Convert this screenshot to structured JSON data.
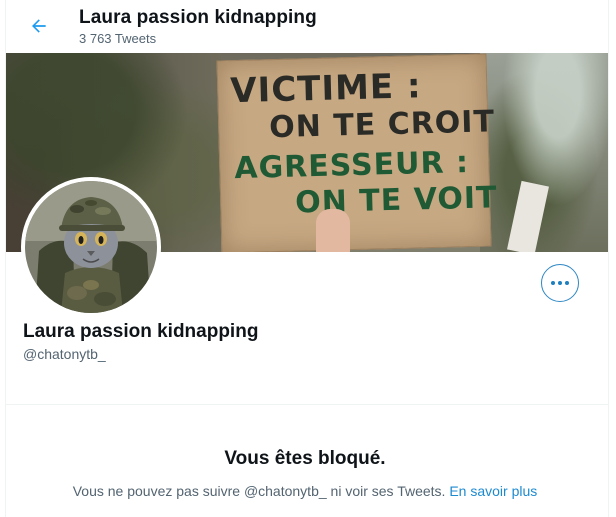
{
  "header": {
    "title": "Laura passion kidnapping",
    "tweet_count": "3 763 Tweets"
  },
  "banner": {
    "sign_lines": [
      "VICTIME :",
      "ON TE CROIT",
      "AGRESSEUR :",
      "ON TE VOIT"
    ]
  },
  "profile": {
    "name": "Laura passion kidnapping",
    "handle": "@chatonytb_"
  },
  "blocked": {
    "title": "Vous êtes bloqué.",
    "message": "Vous ne pouvez pas suivre @chatonytb_ ni voir ses Tweets.",
    "learn_more": "En savoir plus"
  },
  "icons": {
    "back": "arrow-left-icon",
    "more": "more-horizontal-icon"
  },
  "colors": {
    "accent": "#1d9bf0",
    "secondary_text": "#536471",
    "primary_text": "#0f1419"
  }
}
